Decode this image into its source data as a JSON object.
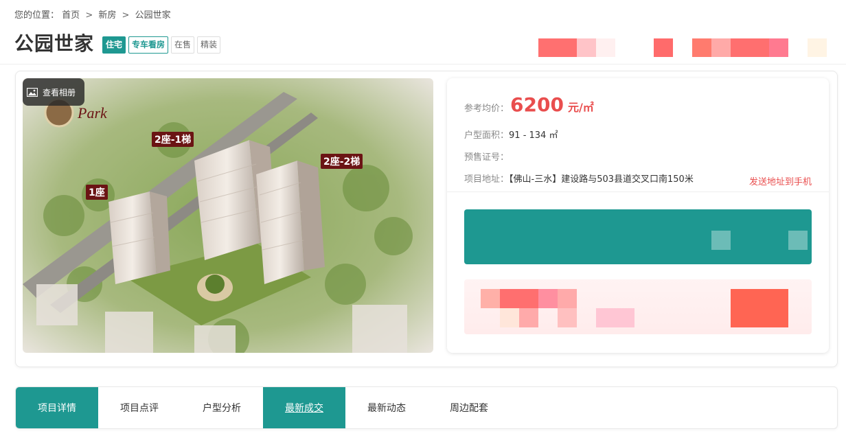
{
  "breadcrumb": {
    "prefix": "您的位置：",
    "items": [
      "首页",
      "新房",
      "公园世家"
    ],
    "separator": ">"
  },
  "title": "公园世家",
  "tags": [
    "住宅",
    "专车看房",
    "在售",
    "精装"
  ],
  "gallery": {
    "album_label": "查看相册",
    "overlay_labels": [
      "2座-1梯",
      "2座-2梯",
      "1座"
    ]
  },
  "info": {
    "price_label": "参考均价：",
    "price_value": "6200",
    "price_unit": "元/㎡",
    "area_label": "户型面积：",
    "area_value": "91 - 134 ㎡",
    "license_label": "预售证号：",
    "license_value": "",
    "address_label": "项目地址：",
    "address_value": "【佛山-三水】建设路与503县道交叉口南150米",
    "send_link": "发送地址到手机"
  },
  "tabs": [
    "项目详情",
    "项目点评",
    "户型分析",
    "最新成交",
    "最新动态",
    "周边配套"
  ],
  "colors": {
    "accent": "#1e9891",
    "price": "#e94e4e"
  }
}
